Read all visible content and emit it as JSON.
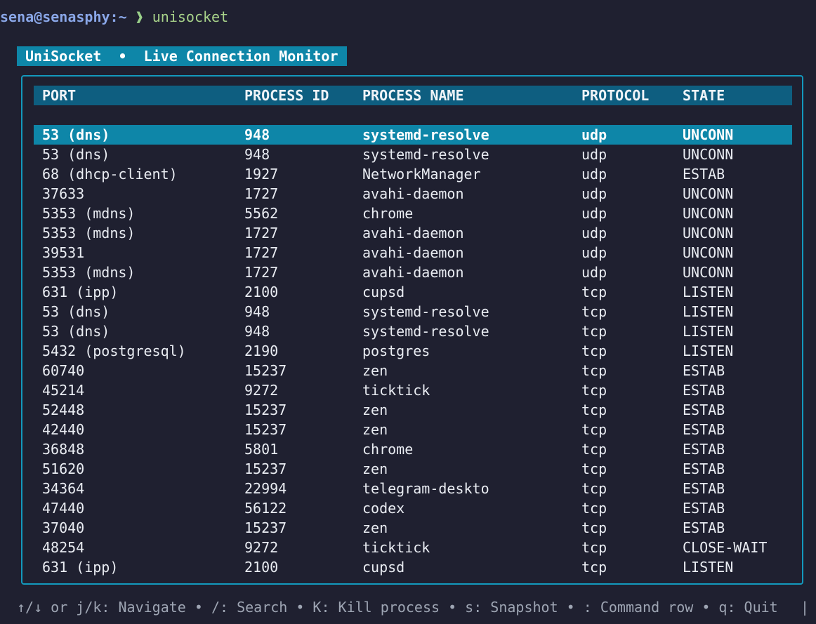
{
  "terminal": {
    "prompt_user": "sena@senasphy:~",
    "prompt_arrow": "❱",
    "command": "unisocket"
  },
  "app": {
    "title": "UniSocket  •  Live Connection Monitor"
  },
  "table": {
    "headers": {
      "port": "PORT",
      "pid": "PROCESS ID",
      "name": "PROCESS NAME",
      "protocol": "PROTOCOL",
      "state": "STATE"
    },
    "selected_index": 0,
    "rows": [
      {
        "port": "53 (dns)",
        "pid": "948",
        "name": "systemd-resolve",
        "protocol": "udp",
        "state": "UNCONN"
      },
      {
        "port": "53 (dns)",
        "pid": "948",
        "name": "systemd-resolve",
        "protocol": "udp",
        "state": "UNCONN"
      },
      {
        "port": "68 (dhcp-client)",
        "pid": "1927",
        "name": "NetworkManager",
        "protocol": "udp",
        "state": "ESTAB"
      },
      {
        "port": "37633",
        "pid": "1727",
        "name": "avahi-daemon",
        "protocol": "udp",
        "state": "UNCONN"
      },
      {
        "port": "5353 (mdns)",
        "pid": "5562",
        "name": "chrome",
        "protocol": "udp",
        "state": "UNCONN"
      },
      {
        "port": "5353 (mdns)",
        "pid": "1727",
        "name": "avahi-daemon",
        "protocol": "udp",
        "state": "UNCONN"
      },
      {
        "port": "39531",
        "pid": "1727",
        "name": "avahi-daemon",
        "protocol": "udp",
        "state": "UNCONN"
      },
      {
        "port": "5353 (mdns)",
        "pid": "1727",
        "name": "avahi-daemon",
        "protocol": "udp",
        "state": "UNCONN"
      },
      {
        "port": "631 (ipp)",
        "pid": "2100",
        "name": "cupsd",
        "protocol": "tcp",
        "state": "LISTEN"
      },
      {
        "port": "53 (dns)",
        "pid": "948",
        "name": "systemd-resolve",
        "protocol": "tcp",
        "state": "LISTEN"
      },
      {
        "port": "53 (dns)",
        "pid": "948",
        "name": "systemd-resolve",
        "protocol": "tcp",
        "state": "LISTEN"
      },
      {
        "port": "5432 (postgresql)",
        "pid": "2190",
        "name": "postgres",
        "protocol": "tcp",
        "state": "LISTEN"
      },
      {
        "port": "60740",
        "pid": "15237",
        "name": "zen",
        "protocol": "tcp",
        "state": "ESTAB"
      },
      {
        "port": "45214",
        "pid": "9272",
        "name": "ticktick",
        "protocol": "tcp",
        "state": "ESTAB"
      },
      {
        "port": "52448",
        "pid": "15237",
        "name": "zen",
        "protocol": "tcp",
        "state": "ESTAB"
      },
      {
        "port": "42440",
        "pid": "15237",
        "name": "zen",
        "protocol": "tcp",
        "state": "ESTAB"
      },
      {
        "port": "36848",
        "pid": "5801",
        "name": "chrome",
        "protocol": "tcp",
        "state": "ESTAB"
      },
      {
        "port": "51620",
        "pid": "15237",
        "name": "zen",
        "protocol": "tcp",
        "state": "ESTAB"
      },
      {
        "port": "34364",
        "pid": "22994",
        "name": "telegram-deskto",
        "protocol": "tcp",
        "state": "ESTAB"
      },
      {
        "port": "47440",
        "pid": "56122",
        "name": "codex",
        "protocol": "tcp",
        "state": "ESTAB"
      },
      {
        "port": "37040",
        "pid": "15237",
        "name": "zen",
        "protocol": "tcp",
        "state": "ESTAB"
      },
      {
        "port": "48254",
        "pid": "9272",
        "name": "ticktick",
        "protocol": "tcp",
        "state": "CLOSE-WAIT"
      },
      {
        "port": "631 (ipp)",
        "pid": "2100",
        "name": "cupsd",
        "protocol": "tcp",
        "state": "LISTEN"
      }
    ]
  },
  "footer": {
    "help": "↑/↓ or j/k: Navigate • /: Search • K: Kill process • s: Snapshot • : Command row • q: Quit",
    "cursor": "|"
  },
  "colors": {
    "background": "#1f2030",
    "accent": "#0e86a8",
    "header_bg": "#0e5e80",
    "border": "#1399bd",
    "prompt_user": "#8aa7e8",
    "prompt_command": "#a8d38a"
  }
}
